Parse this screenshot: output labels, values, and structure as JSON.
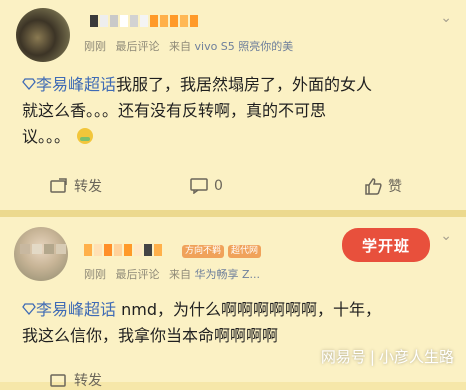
{
  "post1": {
    "meta_time": "刚刚",
    "meta_sort": "最后评论",
    "meta_source_prefix": "来自",
    "meta_device": "vivo S5 照亮你的美",
    "topic": "李易峰超话",
    "body_line1": "我服了，我居然塌房了，外面的女人",
    "body_line2": "就这么香。。。还有没有反转啊，真的不可思",
    "body_line3": "议。。。",
    "emoji_icon": "crying-face-icon",
    "actions": {
      "repost": "转发",
      "comment": "0",
      "like": "赞"
    }
  },
  "post2": {
    "meta_time": "刚刚",
    "meta_sort": "最后评论",
    "meta_source_prefix": "来自",
    "meta_device": "华为畅享 Z...",
    "badge_level": "方向不羁",
    "badge_super": "超代网",
    "stamp": "学开班",
    "topic": "李易峰超话",
    "body_line1": " nmd，为什么啊啊啊啊啊啊，十年，",
    "body_line2": "我这么信你，我拿你当本命啊啊啊啊",
    "actions": {
      "repost": "转发"
    }
  },
  "watermark": {
    "brand": "网易号",
    "author": "小彦人生路"
  },
  "colors": {
    "background": "#fbf1c4",
    "topic": "#3f6bb5",
    "accent": "#e8503c"
  }
}
